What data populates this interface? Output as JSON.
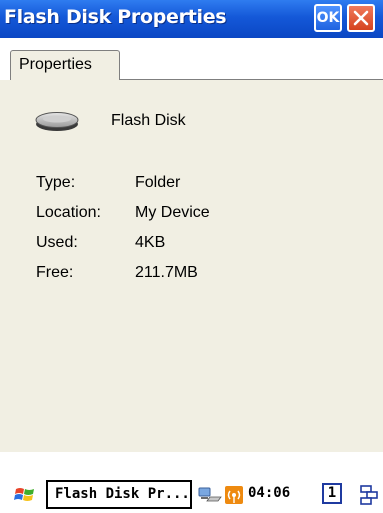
{
  "window": {
    "title": "Flash Disk Properties",
    "ok_label": "OK"
  },
  "tabs": [
    {
      "label": "Properties"
    }
  ],
  "disk": {
    "name": "Flash Disk",
    "icon": "drive-icon"
  },
  "properties": [
    {
      "label": "Type:",
      "value": "Folder"
    },
    {
      "label": "Location:",
      "value": "My Device"
    },
    {
      "label": "Used:",
      "value": "4KB"
    },
    {
      "label": "Free:",
      "value": "211.7MB"
    }
  ],
  "taskbar": {
    "active_task": "Flash Disk Pr...",
    "clock": "04:06",
    "desktop_number": "1"
  },
  "colors": {
    "titlebar": "#1458d8",
    "panel": "#f1efe3",
    "close_button": "#d5431f",
    "wifi": "#ee8a10"
  }
}
